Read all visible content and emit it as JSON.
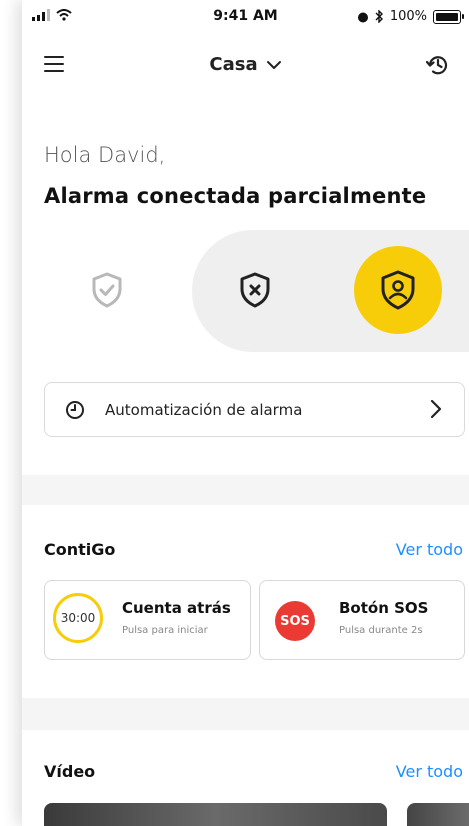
{
  "status_bar": {
    "time": "9:41 AM",
    "battery": "100%"
  },
  "header": {
    "location": "Casa"
  },
  "greeting": "Hola David,",
  "alarm_status": "Alarma  conectada parcialmente",
  "modes": [
    {
      "id": "off",
      "icon": "shield-check-icon",
      "active": false
    },
    {
      "id": "disarm",
      "icon": "shield-x-icon",
      "active": false
    },
    {
      "id": "partial",
      "icon": "shield-person-icon",
      "active": true
    }
  ],
  "automation": {
    "label": "Automatización de alarma"
  },
  "contigo": {
    "title": "ContiGo",
    "see_all": "Ver todo",
    "cards": [
      {
        "badge": "30:00",
        "title": "Cuenta atrás",
        "subtitle": "Pulsa para iniciar"
      },
      {
        "badge": "SOS",
        "title": "Botón SOS",
        "subtitle": "Pulsa durante 2s"
      }
    ]
  },
  "video": {
    "title": "Vídeo",
    "see_all": "Ver todo"
  },
  "colors": {
    "accent_yellow": "#f7cd0a",
    "link_blue": "#1f8fff",
    "sos_red": "#ea3a33"
  }
}
